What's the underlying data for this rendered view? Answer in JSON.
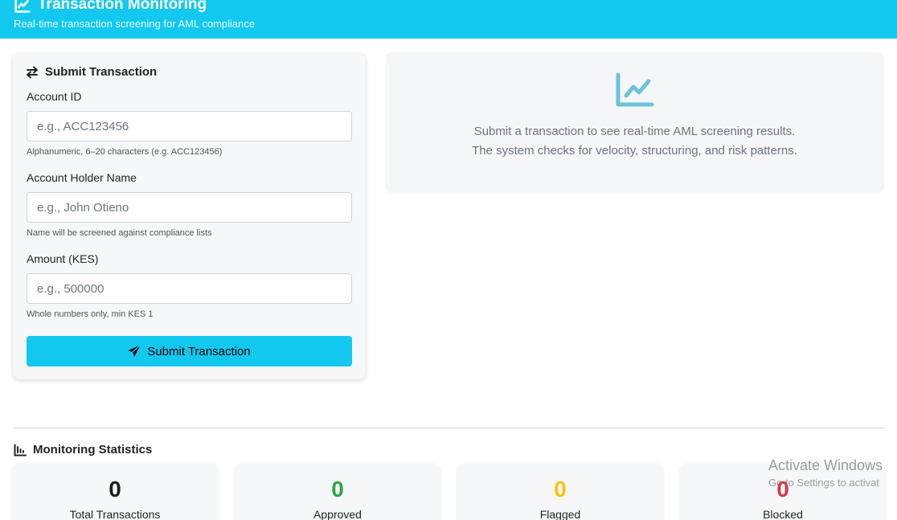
{
  "header": {
    "title": "Transaction Monitoring",
    "subtitle": "Real-time transaction screening for AML compliance",
    "icon": "chart-line-icon"
  },
  "form": {
    "title": "Submit Transaction",
    "title_icon": "exchange-arrows-icon",
    "fields": [
      {
        "label": "Account ID",
        "placeholder": "e.g., ACC123456",
        "value": "",
        "help": "Alphanumeric, 6–20 characters (e.g. ACC123456)"
      },
      {
        "label": "Account Holder Name",
        "placeholder": "e.g., John Otieno",
        "value": "",
        "help": "Name will be screened against compliance lists"
      },
      {
        "label": "Amount (KES)",
        "placeholder": "e.g., 500000",
        "value": "",
        "help": "Whole numbers only, min KES 1"
      }
    ],
    "submit_label": "Submit Transaction",
    "submit_icon": "paper-plane-icon"
  },
  "result_panel": {
    "icon": "chart-line-icon",
    "line1": "Submit a transaction to see real-time AML screening results.",
    "line2": "The system checks for velocity, structuring, and risk patterns."
  },
  "stats": {
    "title": "Monitoring Statistics",
    "title_icon": "bar-chart-icon",
    "cards": [
      {
        "value": "0",
        "label": "Total Transactions",
        "color": "#1b1e21"
      },
      {
        "value": "0",
        "label": "Approved",
        "color": "#28a745"
      },
      {
        "value": "0",
        "label": "Flagged",
        "color": "#ffc107"
      },
      {
        "value": "0",
        "label": "Blocked",
        "color": "#dc3545"
      }
    ]
  },
  "watermark": {
    "line1": "Activate Windows",
    "line2": "Go to Settings to activat"
  },
  "colors": {
    "primary": "#13c8ee",
    "card_bg": "#f6f7f8",
    "muted_text": "#6c757d",
    "result_icon": "#6ec3d6"
  }
}
